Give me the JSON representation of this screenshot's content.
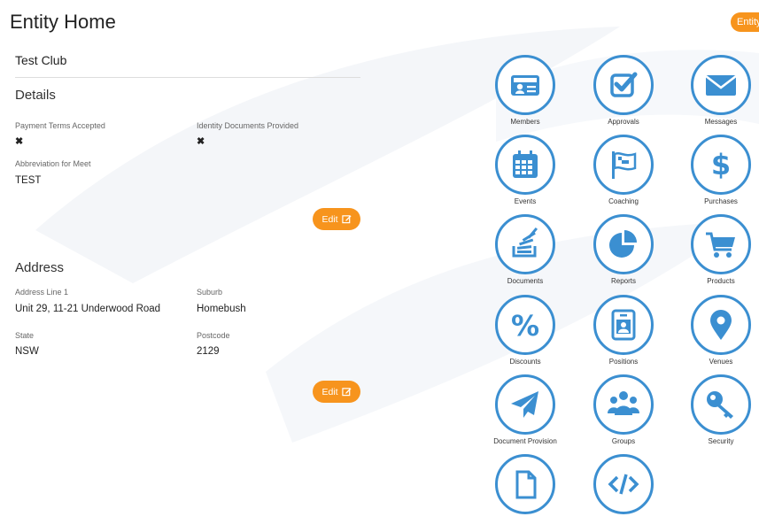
{
  "page": {
    "title": "Entity Home",
    "badge": "Entity"
  },
  "club": {
    "name": "Test Club"
  },
  "details": {
    "heading": "Details",
    "payment_label": "Payment Terms Accepted",
    "identity_label": "Identity Documents Provided",
    "payment_value": "✖",
    "identity_value": "✖",
    "abbrev_label": "Abbreviation for Meet",
    "abbrev_value": "TEST",
    "edit_label": "Edit"
  },
  "address": {
    "heading": "Address",
    "line1_label": "Address Line 1",
    "line1_value": "Unit 29, 11-21 Underwood Road",
    "suburb_label": "Suburb",
    "suburb_value": "Homebush",
    "state_label": "State",
    "state_value": "NSW",
    "postcode_label": "Postcode",
    "postcode_value": "2129",
    "edit_label": "Edit"
  },
  "tiles": [
    {
      "label": "Members",
      "icon": "id-card-icon"
    },
    {
      "label": "Approvals",
      "icon": "check-square-icon"
    },
    {
      "label": "Messages",
      "icon": "envelope-icon"
    },
    {
      "label": "Events",
      "icon": "calendar-icon"
    },
    {
      "label": "Coaching",
      "icon": "flag-icon"
    },
    {
      "label": "Purchases",
      "icon": "dollar-icon"
    },
    {
      "label": "Documents",
      "icon": "stack-icon"
    },
    {
      "label": "Reports",
      "icon": "pie-chart-icon"
    },
    {
      "label": "Products",
      "icon": "cart-icon"
    },
    {
      "label": "Discounts",
      "icon": "percent-icon"
    },
    {
      "label": "Positions",
      "icon": "badge-icon"
    },
    {
      "label": "Venues",
      "icon": "map-marker-icon"
    },
    {
      "label": "Document Provision",
      "icon": "paper-plane-icon"
    },
    {
      "label": "Groups",
      "icon": "users-icon"
    },
    {
      "label": "Security",
      "icon": "key-icon"
    },
    {
      "label": "",
      "icon": "file-icon"
    },
    {
      "label": "",
      "icon": "code-icon"
    }
  ],
  "colors": {
    "accent": "#f7941d",
    "icon_blue": "#3b8fd1"
  }
}
